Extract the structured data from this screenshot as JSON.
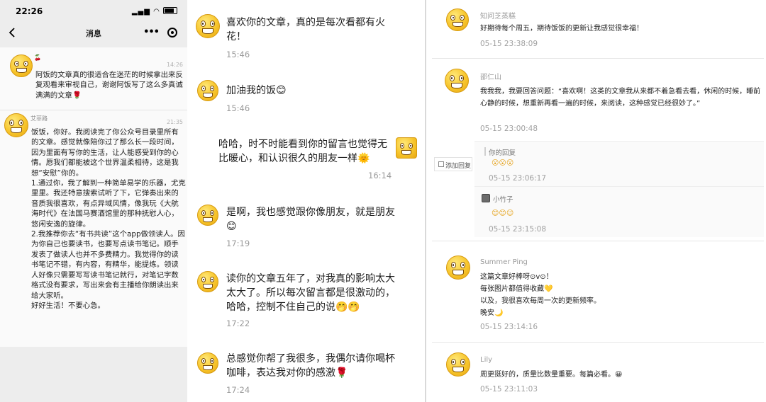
{
  "phone": {
    "status_time": "22:26",
    "title": "消息",
    "messages": [
      {
        "name": "🍒",
        "time": "14:26",
        "text": "阿饭的文章真的很适合在迷茫的时候拿出来反复观看来审视自己，谢谢阿饭写了这么多真诚满满的文章🌹"
      },
      {
        "name": "艾菲路",
        "time": "21:35",
        "text": "饭饭，你好。我阅读完了你公众号目录里所有的文章。感觉就像陪你过了那么长一段时间，因为里面有写你的生活，让人能感受到你的心情。愿我们都能被这个世界温柔相待，这是我想“安慰”你的。\n1.通过你，我了解到一种简单易学的乐器，尤克里里。我还特意搜索试听了下，它弹奏出来的音质我很喜欢，有点异域风情，像我玩《大航海时代》在法国马赛酒馆里的那种抚慰人心，悠闲安逸的旋律。\n2.我推荐你去“有书共读”这个app做领读人。因为你自己也要读书，也要写点读书笔记。顺手发表了做读人也并不多费精力。我觉得你的读书笔记不错，有内容，有精华，能提炼。领读人好像只需要写写读书笔记就行，对笔记字数格式没有要求，写出来会有主播给你朗读出来给大家听。\n好好生活！不要心急。"
      }
    ]
  },
  "middle": {
    "items": [
      {
        "text": "喜欢你的文章，真的是每次看都有火花！",
        "time": "15:46"
      },
      {
        "text": "加油我的饭😊",
        "time": "15:46"
      },
      {
        "text": "哈哈，时不时能看到你的留言也觉得无比暖心，和认识很久的朋友一样🌞",
        "time": "16:14"
      },
      {
        "text": "是啊，我也感觉跟你像朋友，就是朋友😊",
        "time": "17:19"
      },
      {
        "text": "读你的文章五年了，对我真的影响太大太大了。所以每次留言都是很激动的，哈哈，控制不住自己的说🤭🤭",
        "time": "17:22"
      },
      {
        "text": "总感觉你帮了我很多，我偶尔请你喝杯咖啡，表达我对你的感激🌹",
        "time": "17:24"
      }
    ]
  },
  "right": {
    "comments": [
      {
        "name": "知问芝蒸糕",
        "text": "好期待每个周五，期待饭饭的更新让我感觉很幸福！",
        "time": "05-15 23:38:09"
      },
      {
        "name": "邵仁山",
        "text": "我我我，我要回答问题：“喜欢啊！这类的文章我从来都不着急看去看，休闲的时候，睡前心静的时候，想重新再看一遍的时候，来阅读，这种感觉已经很妙了。”",
        "time": "05-15 23:00:48",
        "replies": [
          {
            "name": "你的回复",
            "emoji": "😮😮😮",
            "time": "05-15 23:06:17"
          },
          {
            "name": "小竹子",
            "emoji": "😊😊😉",
            "time": "05-15 23:15:08"
          }
        ]
      },
      {
        "name": "Summer Ping",
        "text": "这篇文章好棒呀⊙v⊙！\n每张图片都值得收藏💛\n以及，我很喜欢每周一次的更新频率。\n晚安🌙",
        "time": "05-15 23:14:16"
      },
      {
        "name": "Lily",
        "text": "周更挺好的，质量比数量重要。每篇必看。😀",
        "time": "05-15 23:11:03"
      }
    ],
    "add_reply_label": "添加回复"
  }
}
